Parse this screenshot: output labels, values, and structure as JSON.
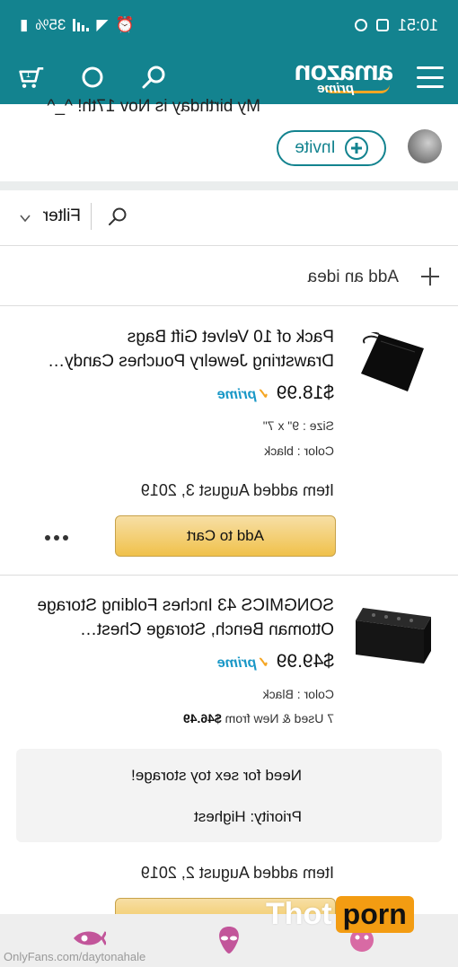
{
  "status_bar": {
    "time": "10:51",
    "battery": "35%"
  },
  "header": {
    "logo_word": "amazon",
    "logo_sub": "prime",
    "icons": [
      "menu-icon",
      "search-icon",
      "alexa-icon",
      "cart-icon"
    ]
  },
  "wishlist": {
    "description": "My birthday is Nov 17th! ^_^",
    "invite_label": "Invite"
  },
  "filter": {
    "label": "Filter"
  },
  "add_idea": {
    "label": "Add an idea"
  },
  "items": [
    {
      "title_line1": "Pack of 10 Velvet Gift Bags",
      "title_line2": "Drawstring Jewelry Pouches Candy…",
      "price": "$18.99",
      "prime": "prime",
      "size": "Size : 9\" x 7\"",
      "color": "Color : black",
      "added": "Item added August 3, 2019",
      "cart_label": "Add to Cart"
    },
    {
      "title_line1": "SONGMICS 43 Inches Folding Storage",
      "title_line2": "Ottoman Bench, Storage Chest…",
      "price": "$49.99",
      "prime": "prime",
      "color": "Color : Black",
      "used_prefix": "7 Used & New from",
      "used_price": "$46.49",
      "note_comment": "Need for sex toy storage!",
      "note_priority": "Priority:  Highest",
      "added": "Item added August 2, 2019"
    }
  ],
  "overlay": {
    "watermark": "OnlyFans.com/daytonahale",
    "logo_left": "Thot",
    "logo_right": "porn"
  },
  "colors": {
    "brand_teal": "#13838f",
    "cart_yellow": "#f0c14b",
    "prime_blue": "#1a98c7",
    "logo_orange": "#f39c12"
  }
}
